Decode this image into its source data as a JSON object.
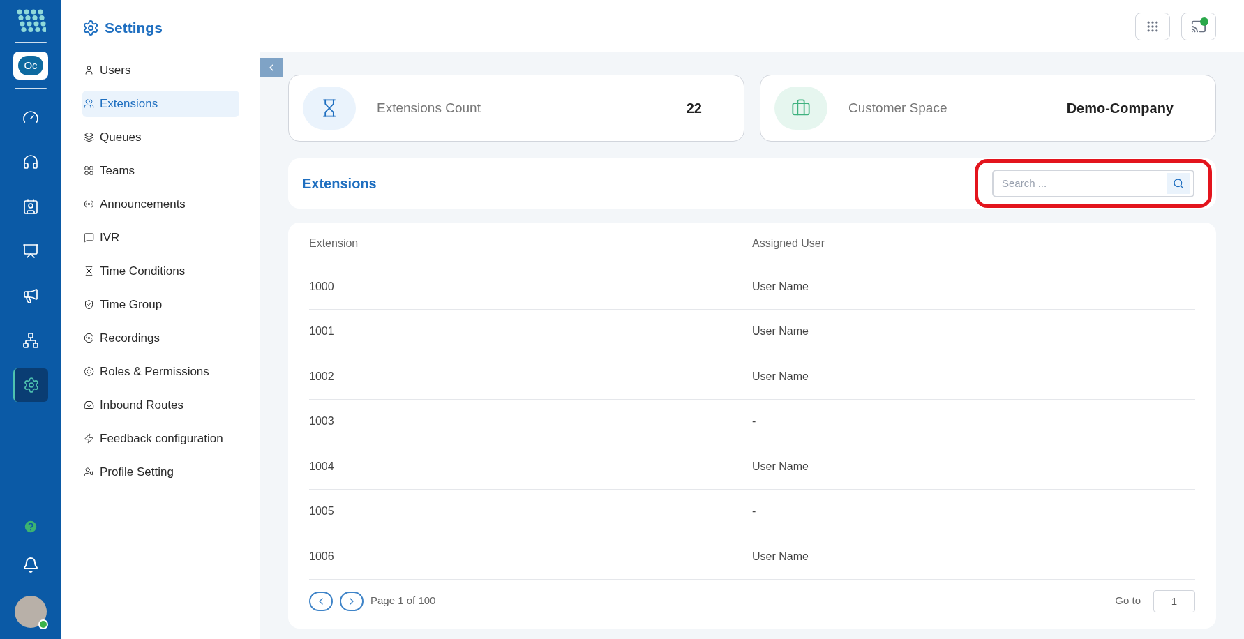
{
  "rail": {
    "workspace_badge": "Oc",
    "items": [
      {
        "selected": false
      },
      {
        "selected": false
      },
      {
        "selected": false
      },
      {
        "selected": false
      },
      {
        "selected": false
      },
      {
        "selected": false
      },
      {
        "selected": true
      }
    ],
    "user_online": true
  },
  "sidebar": {
    "title": "Settings",
    "items": [
      {
        "label": "Users",
        "selected": false
      },
      {
        "label": "Extensions",
        "selected": true
      },
      {
        "label": "Queues",
        "selected": false
      },
      {
        "label": "Teams",
        "selected": false
      },
      {
        "label": "Announcements",
        "selected": false
      },
      {
        "label": "IVR",
        "selected": false
      },
      {
        "label": "Time Conditions",
        "selected": false
      },
      {
        "label": "Time Group",
        "selected": false
      },
      {
        "label": "Recordings",
        "selected": false
      },
      {
        "label": "Roles & Permissions",
        "selected": false
      },
      {
        "label": "Inbound Routes",
        "selected": false
      },
      {
        "label": "Feedback configuration",
        "selected": false
      },
      {
        "label": "Profile Setting",
        "selected": false
      }
    ]
  },
  "header": {
    "cast_connected": true
  },
  "stats": [
    {
      "label": "Extensions Count",
      "value": "22"
    },
    {
      "label": "Customer Space",
      "value": "Demo-Company"
    }
  ],
  "section": {
    "title": "Extensions",
    "search": {
      "placeholder": "Search ..."
    }
  },
  "table": {
    "columns": [
      "Extension",
      "Assigned User"
    ],
    "rows": [
      [
        "1000",
        "User Name"
      ],
      [
        "1001",
        "User Name"
      ],
      [
        "1002",
        "User Name"
      ],
      [
        "1003",
        "-"
      ],
      [
        "1004",
        "User Name"
      ],
      [
        "1005",
        "-"
      ],
      [
        "1006",
        "User Name"
      ]
    ]
  },
  "pagination": {
    "page_text": "Page 1 of 100",
    "goto_label": "Go to",
    "goto_value": "1"
  }
}
